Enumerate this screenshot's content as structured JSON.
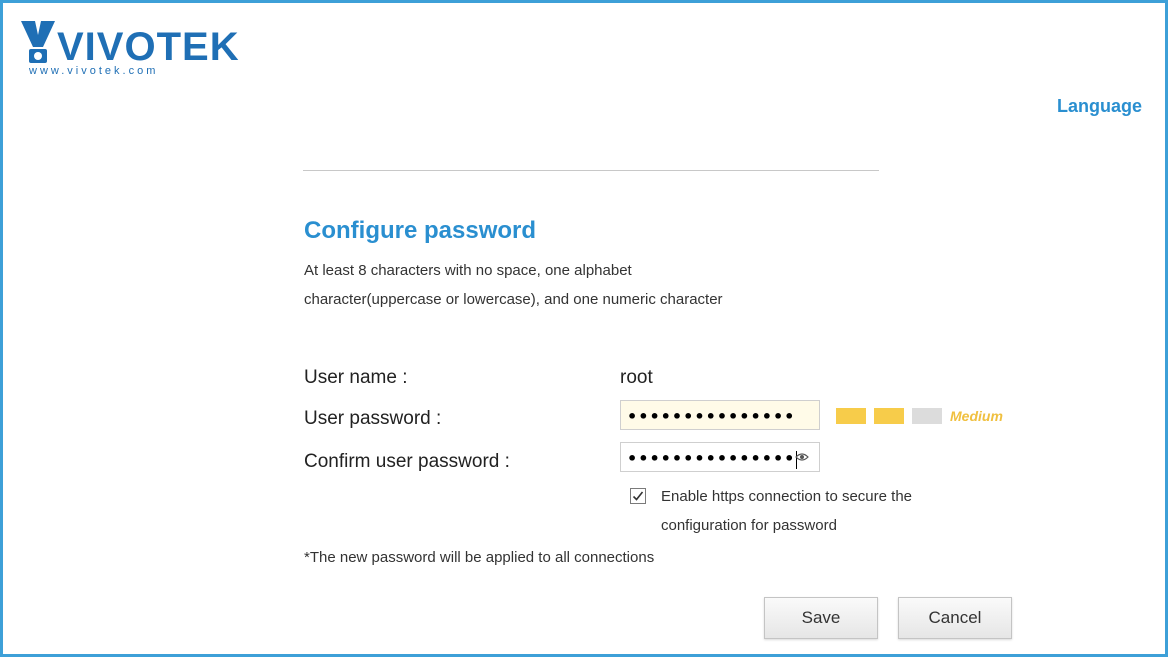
{
  "brand": {
    "name": "VIVOTEK",
    "url": "www.vivotek.com",
    "color": "#1f6fb5"
  },
  "header": {
    "language_label": "Language"
  },
  "form": {
    "title": "Configure password",
    "description": "At least 8 characters with no space, one alphabet character(uppercase or lowercase), and one numeric character",
    "username_label": "User name :",
    "username_value": "root",
    "password_label": "User password :",
    "password_value": "•••••••••••••••",
    "confirm_label": "Confirm user password :",
    "confirm_value": "•••••••••••••••",
    "strength": {
      "label": "Medium",
      "filled_segments": 2,
      "total_segments": 3,
      "color": "#f7cc4a"
    },
    "https_checkbox": {
      "checked": true,
      "label": "Enable https connection to secure the configuration for password"
    },
    "note": "*The new password will be applied to all connections"
  },
  "actions": {
    "save_label": "Save",
    "cancel_label": "Cancel"
  },
  "icons": {
    "logo": "vivotek-logo",
    "show_password": "eye-icon",
    "checkmark": "check-icon"
  },
  "colors": {
    "accent": "#2a8fd0",
    "frame": "#3da0d8"
  }
}
